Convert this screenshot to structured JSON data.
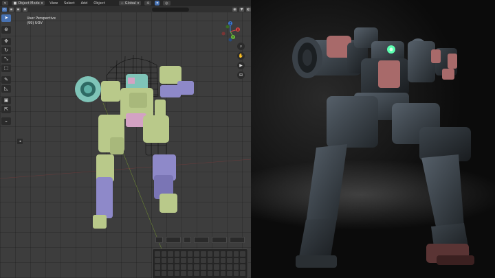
{
  "header": {
    "mode_label": "Object Mode",
    "menus": [
      "View",
      "Select",
      "Add",
      "Object"
    ],
    "transform_orientation": "Global"
  },
  "viewport": {
    "view_name": "User Perspective",
    "collection_label": "(99) UOV"
  },
  "tools": [
    "select-box-tool",
    "cursor-tool",
    "move-tool",
    "rotate-tool",
    "scale-tool",
    "transform-tool",
    "annotate-tool",
    "measure-tool",
    "add-cube-tool",
    "extrude-tool",
    "edit-tool"
  ],
  "gizmo_axes": {
    "x": "X",
    "y": "Y",
    "z": "Z"
  },
  "colors": {
    "accent": "#4772b3",
    "header_bg": "#262626",
    "viewport_bg": "#3d3d3d",
    "model_green": "#b9c98a",
    "model_purple": "#8e89c9",
    "model_teal": "#7fc4b8",
    "model_pink": "#d3a2c3",
    "render_armor": "#3b4146",
    "render_accent": "#a86a6a",
    "render_eye": "#5cffb0"
  }
}
